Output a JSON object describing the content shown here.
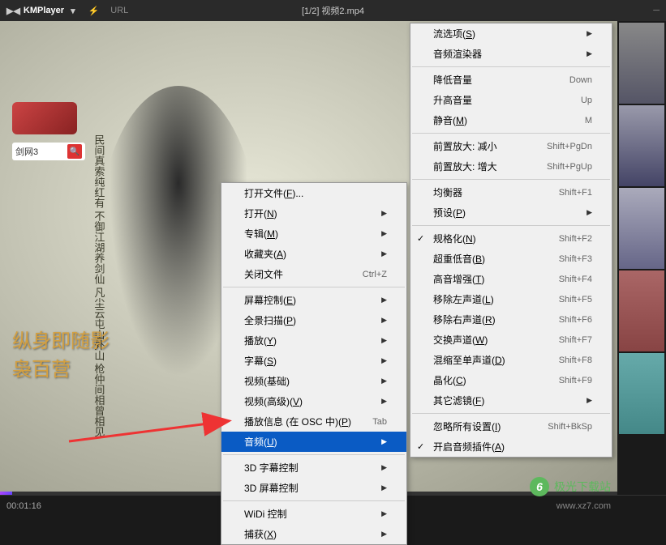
{
  "titlebar": {
    "logo": "KMPlayer",
    "url_label": "URL",
    "title": "[1/2] 视频2.mp4"
  },
  "video": {
    "search_text": "剑网3",
    "vertical_poem": "民间真索纯红有 不御江湖养剑仙\n凡尘云屯山外山 枪仲间相曾相见",
    "bottom_text1": "纵身即随影",
    "bottom_text2": "袅百营"
  },
  "watermark": {
    "text": "极光下载站",
    "url": "www.xz7.com"
  },
  "playback": {
    "current_time": "00:01:16"
  },
  "menu1": {
    "items": [
      {
        "label": "打开文件(F)...",
        "shortcut": "",
        "arrow": false
      },
      {
        "label": "打开(N)",
        "shortcut": "",
        "arrow": true
      },
      {
        "label": "专辑(M)",
        "shortcut": "",
        "arrow": true
      },
      {
        "label": "收藏夹(A)",
        "shortcut": "",
        "arrow": true
      },
      {
        "label": "关闭文件",
        "shortcut": "Ctrl+Z",
        "arrow": false
      },
      {
        "sep": true
      },
      {
        "label": "屏幕控制(E)",
        "shortcut": "",
        "arrow": true
      },
      {
        "label": "全景扫描(P)",
        "shortcut": "",
        "arrow": true
      },
      {
        "label": "播放(Y)",
        "shortcut": "",
        "arrow": true
      },
      {
        "label": "字幕(S)",
        "shortcut": "",
        "arrow": true
      },
      {
        "label": "视频(基础)",
        "shortcut": "",
        "arrow": true
      },
      {
        "label": "视频(高级)(V)",
        "shortcut": "",
        "arrow": true
      },
      {
        "label": "播放信息 (在 OSC 中)(P)",
        "shortcut": "Tab",
        "arrow": false
      },
      {
        "label": "音频(U)",
        "shortcut": "",
        "arrow": true,
        "selected": true
      },
      {
        "sep": true
      },
      {
        "label": "3D 字幕控制",
        "shortcut": "",
        "arrow": true
      },
      {
        "label": "3D 屏幕控制",
        "shortcut": "",
        "arrow": true
      },
      {
        "sep": true
      },
      {
        "label": "WiDi 控制",
        "shortcut": "",
        "arrow": true
      },
      {
        "label": "捕获(X)",
        "shortcut": "",
        "arrow": true
      }
    ]
  },
  "menu2": {
    "items": [
      {
        "label": "流选项(S)",
        "shortcut": "",
        "arrow": true
      },
      {
        "label": "音频渲染器",
        "shortcut": "",
        "arrow": true
      },
      {
        "sep": true
      },
      {
        "label": "降低音量",
        "shortcut": "Down",
        "arrow": false
      },
      {
        "label": "升高音量",
        "shortcut": "Up",
        "arrow": false
      },
      {
        "label": "静音(M)",
        "shortcut": "M",
        "arrow": false
      },
      {
        "sep": true
      },
      {
        "label": "前置放大: 减小",
        "shortcut": "Shift+PgDn",
        "arrow": false
      },
      {
        "label": "前置放大: 增大",
        "shortcut": "Shift+PgUp",
        "arrow": false
      },
      {
        "sep": true
      },
      {
        "label": "均衡器",
        "shortcut": "Shift+F1",
        "arrow": false
      },
      {
        "label": "预设(P)",
        "shortcut": "",
        "arrow": true
      },
      {
        "sep": true
      },
      {
        "label": "规格化(N)",
        "shortcut": "Shift+F2",
        "arrow": false,
        "checked": true
      },
      {
        "label": "超重低音(B)",
        "shortcut": "Shift+F3",
        "arrow": false
      },
      {
        "label": "高音增强(T)",
        "shortcut": "Shift+F4",
        "arrow": false
      },
      {
        "label": "移除左声道(L)",
        "shortcut": "Shift+F5",
        "arrow": false
      },
      {
        "label": "移除右声道(R)",
        "shortcut": "Shift+F6",
        "arrow": false
      },
      {
        "label": "交换声道(W)",
        "shortcut": "Shift+F7",
        "arrow": false
      },
      {
        "label": "混缩至单声道(D)",
        "shortcut": "Shift+F8",
        "arrow": false
      },
      {
        "label": "晶化(C)",
        "shortcut": "Shift+F9",
        "arrow": false
      },
      {
        "label": "其它滤镜(F)",
        "shortcut": "",
        "arrow": true
      },
      {
        "sep": true
      },
      {
        "label": "忽略所有设置(I)",
        "shortcut": "Shift+BkSp",
        "arrow": false
      },
      {
        "label": "开启音频插件(A)",
        "shortcut": "",
        "arrow": false,
        "checked": true
      }
    ]
  }
}
